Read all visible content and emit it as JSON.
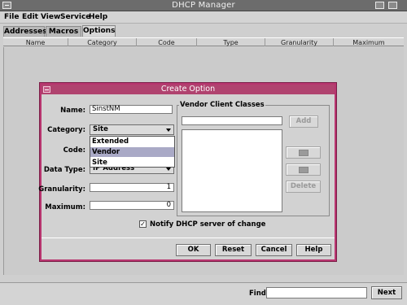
{
  "window": {
    "title": "DHCP Manager"
  },
  "menubar": {
    "items": [
      "File",
      "Edit",
      "View",
      "Service",
      "Help"
    ]
  },
  "tabs": [
    "Addresses",
    "Macros",
    "Options"
  ],
  "table": {
    "columns": [
      "Name",
      "Category",
      "Code",
      "Type",
      "Granularity",
      "Maximum"
    ]
  },
  "dialog": {
    "title": "Create Option",
    "labels": {
      "name": "Name:",
      "category": "Category:",
      "code": "Code:",
      "data_type": "Data Type:",
      "granularity": "Granularity:",
      "maximum": "Maximum:"
    },
    "name_value": "SinstNM",
    "category_value": "Site",
    "category_options": [
      "Extended",
      "Vendor",
      "Site"
    ],
    "category_highlighted": "Vendor",
    "data_type_value": "IP Address",
    "granularity_value": "1",
    "maximum_value": "0",
    "vendor_group_title": "Vendor Client Classes",
    "add_label": "Add",
    "delete_label": "Delete",
    "notify_label": "Notify DHCP server of change",
    "notify_checked": "✓",
    "buttons": {
      "ok": "OK",
      "reset": "Reset",
      "cancel": "Cancel",
      "help": "Help"
    }
  },
  "findbar": {
    "label": "Find:",
    "value": "",
    "next_label": "Next"
  },
  "colors": {
    "dialog_border": "#b8356f",
    "dialog_title": "#b0436f",
    "dropdown_highlight": "#a9a9c6"
  }
}
